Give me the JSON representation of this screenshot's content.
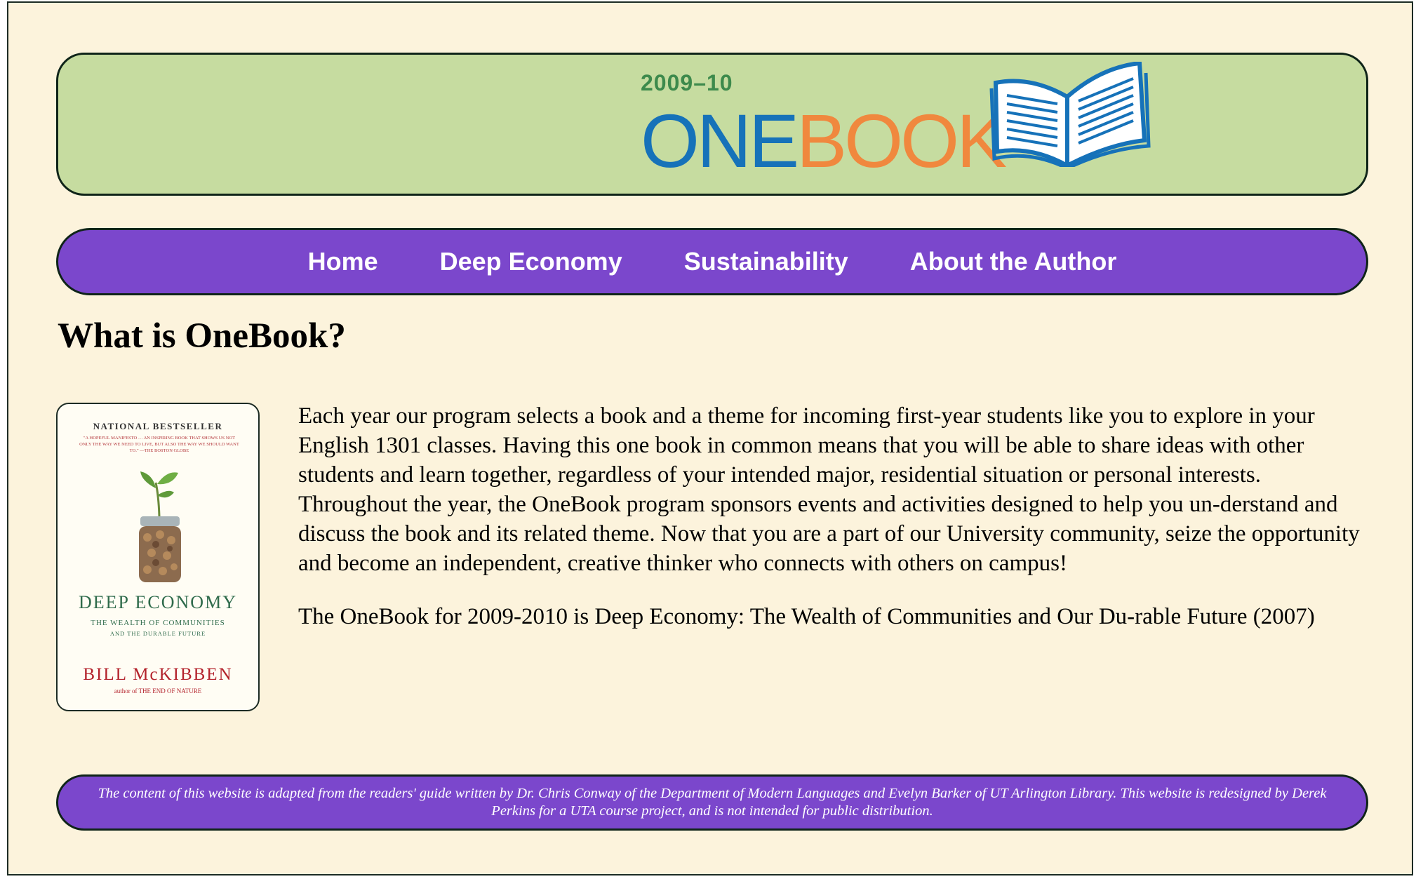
{
  "banner": {
    "year": "2009–10",
    "logo_one": "ONE",
    "logo_book": "BOOK",
    "book_icon": "open-book-icon"
  },
  "nav": {
    "items": [
      {
        "label": "Home"
      },
      {
        "label": "Deep Economy"
      },
      {
        "label": "Sustainability"
      },
      {
        "label": "About the Author"
      }
    ]
  },
  "main": {
    "heading": "What is OneBook?",
    "cover": {
      "badge": "NATIONAL BESTSELLER",
      "blurb": "\"A HOPEFUL MANIFESTO … AN INSPIRING BOOK THAT SHOWS US NOT ONLY THE WAY WE NEED TO LIVE, BUT ALSO THE WAY WE SHOULD WANT TO.\" —THE BOSTON GLOBE",
      "title": "DEEP ECONOMY",
      "subtitle": "THE WEALTH OF COMMUNITIES",
      "subtitle2": "AND THE DURABLE FUTURE",
      "author": "BILL McKIBBEN",
      "author_note": "author of THE END OF NATURE"
    },
    "paragraphs": [
      "Each year our program selects a book and a theme for incoming first-year students like you to explore in your English 1301 classes. Having this one book in common means that you will be able to share ideas with other students and learn together, regardless of your intended major, residential situation or personal interests. Throughout the year, the OneBook program sponsors events and activities designed to help you un-derstand and discuss the book and its related theme. Now that you are a part of our University community, seize the opportunity and become an independent, creative thinker who connects with others on campus!",
      "The OneBook for 2009-2010 is Deep Economy: The Wealth of Communities and Our Du-rable Future (2007)"
    ]
  },
  "footer": {
    "text": "The content of this website is adapted from the readers' guide written by Dr. Chris Conway of the Department of Modern Languages and Evelyn Barker of UT Arlington Library. This website is redesigned by Derek Perkins for a UTA course project, and is not intended for public distribution."
  },
  "colors": {
    "page_bg": "#fcf3dc",
    "banner_bg": "#c6dca0",
    "nav_bg": "#7b47cc",
    "logo_blue": "#1672b9",
    "logo_orange": "#f0883e",
    "year_green": "#3d8a4c"
  }
}
